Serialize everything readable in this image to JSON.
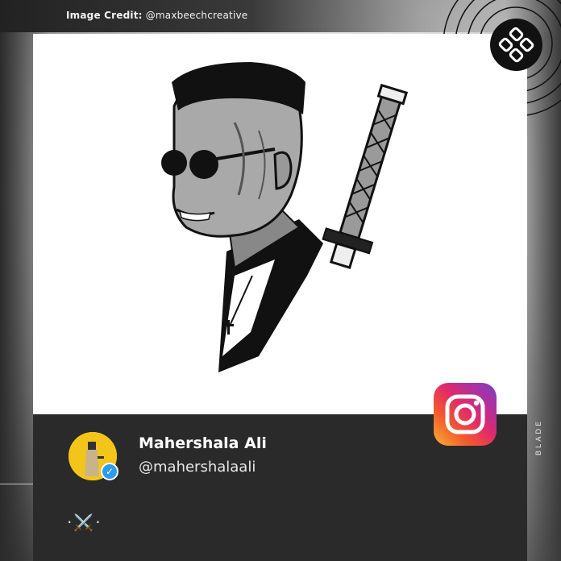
{
  "credit": {
    "label": "Image Credit:",
    "handle": "@maxbeechcreative"
  },
  "profile": {
    "name": "Mahershala Ali",
    "handle": "@mahershalaali",
    "bio": "·⚔️·",
    "verified_symbol": "✓"
  },
  "side_text": "BLADE",
  "icons": {
    "site_logo": "gamepad-logo-icon",
    "instagram": "instagram-icon",
    "verified": "verified-badge-icon"
  },
  "colors": {
    "card_footer": "#2a2a2a",
    "verified": "#2e9bf0",
    "avatar_bg": "#f3c51a"
  }
}
